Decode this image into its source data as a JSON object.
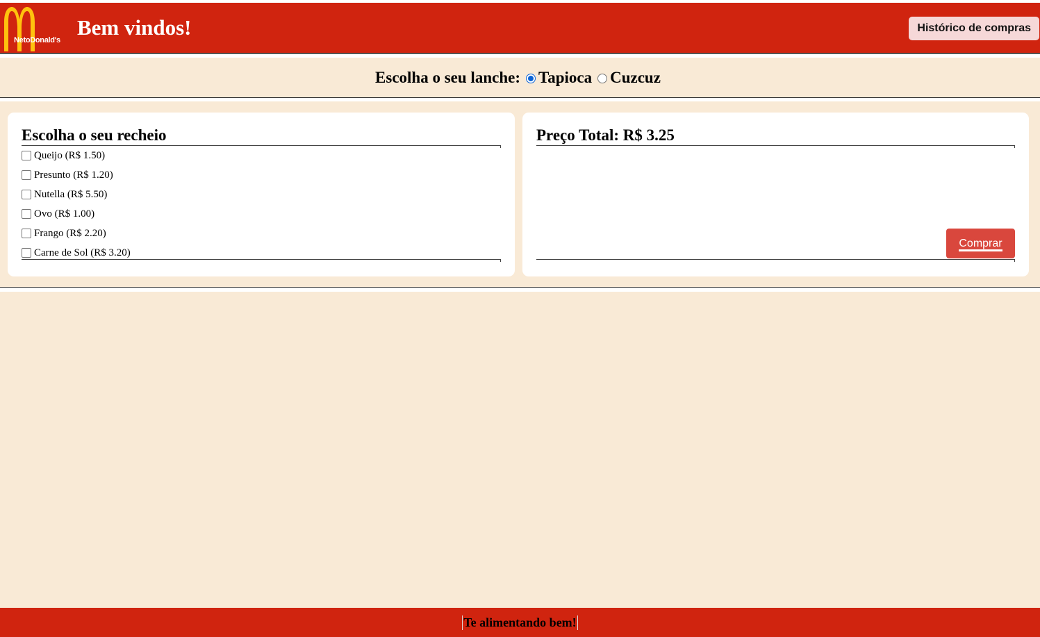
{
  "header": {
    "logo_text": "NetoDonald's",
    "title": "Bem vindos!",
    "history_button": "Histórico de compras"
  },
  "snack_choice": {
    "question": "Escolha o seu lanche:",
    "options": [
      {
        "label": "Tapioca",
        "checked": true
      },
      {
        "label": "Cuzcuz",
        "checked": false
      }
    ]
  },
  "fillings": {
    "title": "Escolha o seu recheio",
    "items": [
      {
        "label": "Queijo (R$ 1.50)",
        "checked": false
      },
      {
        "label": "Presunto (R$ 1.20)",
        "checked": false
      },
      {
        "label": "Nutella (R$ 5.50)",
        "checked": false
      },
      {
        "label": "Ovo (R$ 1.00)",
        "checked": false
      },
      {
        "label": "Frango (R$ 2.20)",
        "checked": false
      },
      {
        "label": "Carne de Sol (R$ 3.20)",
        "checked": false
      }
    ]
  },
  "total": {
    "title": "Preço Total: R$ 3.25",
    "buy_button": "Comprar"
  },
  "footer": {
    "text": "Te alimentando bem!"
  },
  "colors": {
    "brand_red": "#d0240f",
    "background": "#f9ead6",
    "logo_yellow": "#ffc20e",
    "radio_accent": "#0b63d6",
    "buy_button": "#d9473d"
  }
}
